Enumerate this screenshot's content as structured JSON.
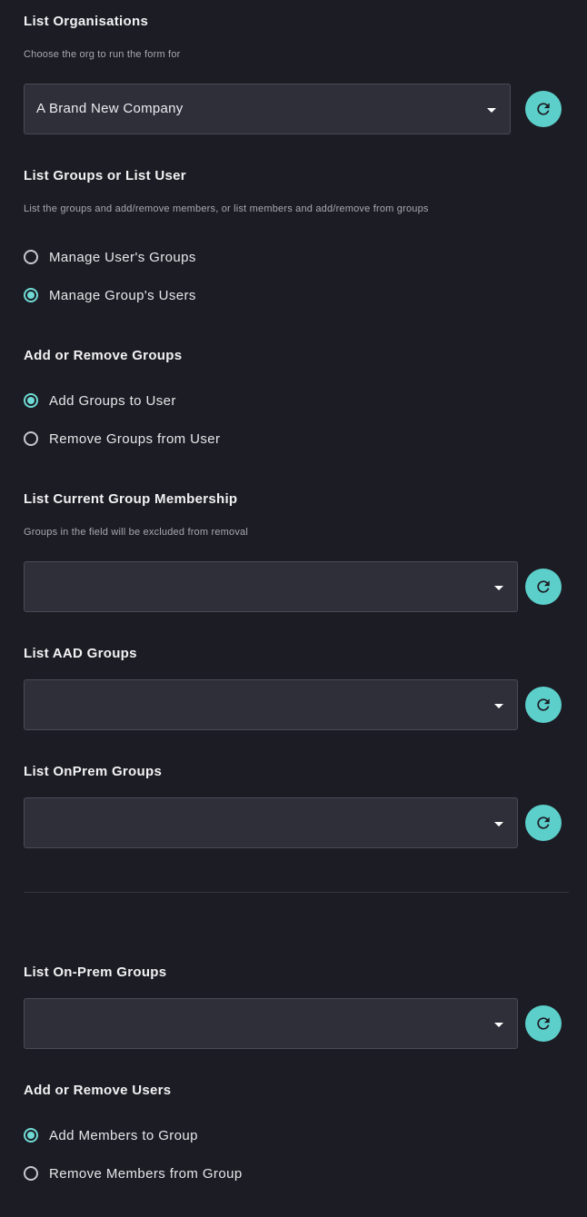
{
  "org": {
    "title": "List Organisations",
    "desc": "Choose the org to run the form for",
    "selected": "A Brand New Company"
  },
  "list_mode": {
    "title": "List Groups or List User",
    "desc": "List the groups and add/remove members, or list members and add/remove from groups",
    "options": [
      "Manage User's Groups",
      "Manage Group's Users"
    ],
    "selected_index": 1
  },
  "add_remove_groups": {
    "title": "Add or Remove Groups",
    "options": [
      "Add Groups to User",
      "Remove Groups from User"
    ],
    "selected_index": 0
  },
  "current_membership": {
    "title": "List Current Group Membership",
    "desc": "Groups in the field will be excluded from removal",
    "selected": ""
  },
  "aad_groups": {
    "title": "List AAD Groups",
    "selected": ""
  },
  "onprem_groups": {
    "title": "List OnPrem Groups",
    "selected": ""
  },
  "on_prem_groups_2": {
    "title": "List On-Prem Groups",
    "selected": ""
  },
  "add_remove_users": {
    "title": "Add or Remove Users",
    "options": [
      "Add Members to Group",
      "Remove Members from Group"
    ],
    "selected_index": 0
  },
  "colors": {
    "background": "#1c1c24",
    "field": "#2f2f3a",
    "accent": "#5ccfca"
  },
  "icons": {
    "refresh": "refresh-icon",
    "dropdown": "caret-down-icon"
  }
}
